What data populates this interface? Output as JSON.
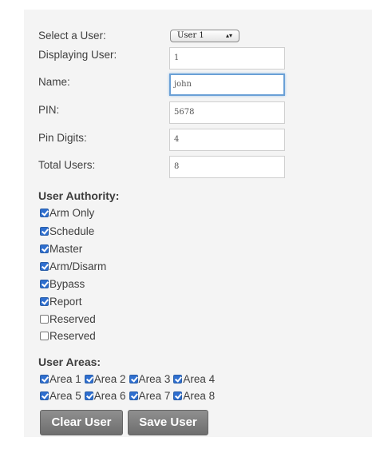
{
  "form": {
    "select_user_label": "Select a User:",
    "select_user_value": "User 1",
    "displaying_user_label": "Displaying User:",
    "displaying_user_value": "1",
    "name_label": "Name:",
    "name_value": "john",
    "pin_label": "PIN:",
    "pin_value": "5678",
    "pin_digits_label": "Pin Digits:",
    "pin_digits_value": "4",
    "total_users_label": "Total Users:",
    "total_users_value": "8"
  },
  "authority": {
    "title": "User Authority:",
    "items": [
      {
        "label": "Arm Only",
        "checked": true
      },
      {
        "label": "Schedule",
        "checked": true
      },
      {
        "label": "Master",
        "checked": true
      },
      {
        "label": "Arm/Disarm",
        "checked": true
      },
      {
        "label": "Bypass",
        "checked": true
      },
      {
        "label": "Report",
        "checked": true
      },
      {
        "label": "Reserved",
        "checked": false
      },
      {
        "label": "Reserved",
        "checked": false
      }
    ]
  },
  "areas": {
    "title": "User Areas:",
    "items": [
      {
        "label": "Area 1",
        "checked": true
      },
      {
        "label": "Area 2",
        "checked": true
      },
      {
        "label": "Area 3",
        "checked": true
      },
      {
        "label": "Area 4",
        "checked": true
      },
      {
        "label": "Area 5",
        "checked": true
      },
      {
        "label": "Area 6",
        "checked": true
      },
      {
        "label": "Area 7",
        "checked": true
      },
      {
        "label": "Area 8",
        "checked": true
      }
    ]
  },
  "buttons": {
    "clear_label": "Clear User",
    "save_label": "Save User"
  },
  "colors": {
    "accent": "#2f6fcf",
    "button": "#7d7d7d",
    "panel": "#f4f4f4",
    "focus": "#6aa0d6"
  }
}
